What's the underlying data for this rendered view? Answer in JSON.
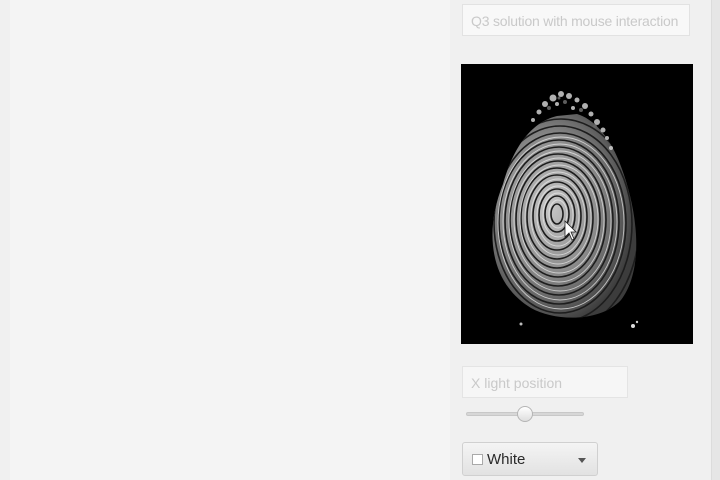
{
  "header": {
    "title": "Q3 solution with mouse interaction"
  },
  "render_view": {
    "image": "fingerprint-surface-render",
    "background_color": "#000000",
    "cursor": "pointer-arrow-icon"
  },
  "light_control": {
    "label": "X light position",
    "slider_level": 0.5
  },
  "color_select": {
    "selected": "White",
    "swatch_color": "#ffffff",
    "caret_icon": "caret-down-icon"
  }
}
